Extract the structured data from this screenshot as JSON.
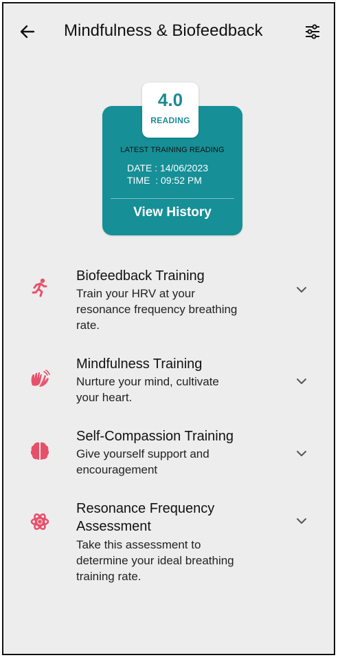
{
  "header": {
    "title": "Mindfulness & Biofeedback"
  },
  "reading_card": {
    "value": "4.0",
    "value_label": "READING",
    "heading": "LATEST TRAINING READING",
    "date": "DATE : 14/06/2023",
    "time": "TIME  : 09:52 PM",
    "history_button": "View History"
  },
  "trainings": [
    {
      "title": "Biofeedback Training",
      "description_lines": [
        "Train your HRV at your",
        "resonance frequency breathing",
        "rate."
      ],
      "icon": "running-person-icon"
    },
    {
      "title": "Mindfulness Training",
      "description_lines": [
        "Nurture your mind, cultivate",
        "your heart."
      ],
      "icon": "waving-hands-icon"
    },
    {
      "title": "Self-Compassion Training",
      "description_lines": [
        "Give yourself support and",
        "encouragement"
      ],
      "icon": "brain-icon"
    },
    {
      "title_lines": [
        "Resonance Frequency",
        "Assessment"
      ],
      "description_lines": [
        "Take this assessment to",
        "determine your ideal breathing",
        "training rate."
      ],
      "icon": "atom-icon"
    }
  ],
  "colors": {
    "accent_teal": "#168f97",
    "icon_pink": "#e8506a",
    "background": "#ededed"
  }
}
